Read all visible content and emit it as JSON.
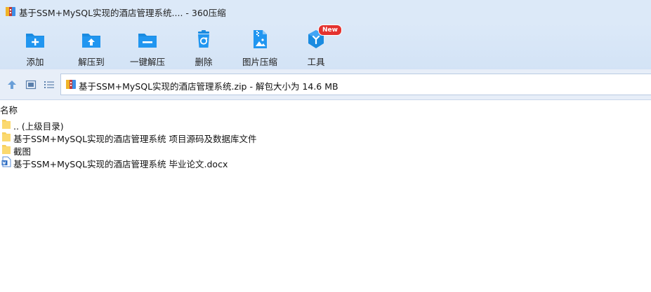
{
  "window": {
    "title": "基于SSM+MySQL实现的酒店管理系统.... - 360压缩"
  },
  "toolbar": {
    "buttons": [
      {
        "label": "添加",
        "icon": "add-folder-icon"
      },
      {
        "label": "解压到",
        "icon": "extract-to-folder-icon"
      },
      {
        "label": "一键解压",
        "icon": "one-click-extract-icon"
      },
      {
        "label": "删除",
        "icon": "recycle-delete-icon"
      },
      {
        "label": "图片压缩",
        "icon": "image-compress-icon"
      },
      {
        "label": "工具",
        "icon": "tools-cube-icon",
        "badge": "New"
      }
    ]
  },
  "addressbar": {
    "path": "基于SSM+MySQL实现的酒店管理系统.zip - 解包大小为 14.6 MB"
  },
  "filelist": {
    "column_name": "名称",
    "items": [
      {
        "name": ".. (上级目录)",
        "type": "folder"
      },
      {
        "name": "基于SSM+MySQL实现的酒店管理系统 项目源码及数据库文件",
        "type": "folder"
      },
      {
        "name": "截图",
        "type": "folder"
      },
      {
        "name": "基于SSM+MySQL实现的酒店管理系统 毕业论文.docx",
        "type": "docx"
      }
    ]
  },
  "colors": {
    "accent": "#1a8be0",
    "toolbar_bg": "#d6e5f7",
    "badge": "#e4322f",
    "folder": "#f7cf5c"
  }
}
